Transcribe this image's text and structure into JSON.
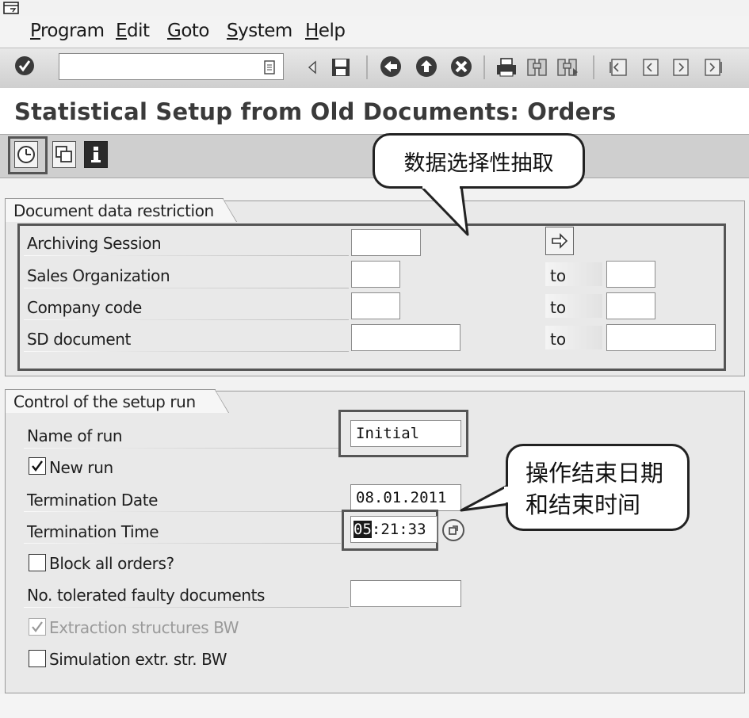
{
  "menu": {
    "program": "Program",
    "edit": "Edit",
    "goto": "Goto",
    "system": "System",
    "help": "Help"
  },
  "page_title": "Statistical Setup from Old Documents: Orders",
  "doc_restriction": {
    "title": "Document data restriction",
    "rows": [
      {
        "label": "Archiving Session"
      },
      {
        "label": "Sales Organization",
        "to": "to"
      },
      {
        "label": "Company code",
        "to": "to"
      },
      {
        "label": "SD document",
        "to": "to"
      }
    ]
  },
  "setup_control": {
    "title": "Control of the setup run",
    "name_of_run": {
      "label": "Name of run",
      "value": "Initial"
    },
    "new_run": {
      "label": "New run",
      "checked": true
    },
    "termination_date": {
      "label": "Termination Date",
      "value": "08.01.2011"
    },
    "termination_time": {
      "label": "Termination Time",
      "selected": "05",
      "rest": ":21:33"
    },
    "block_all": {
      "label": "Block all orders?",
      "checked": false
    },
    "tolerated": {
      "label": "No. tolerated faulty documents"
    },
    "extraction_bw": {
      "label": "Extraction structures BW",
      "checked": true,
      "disabled": true
    },
    "simulation_bw": {
      "label": "Simulation extr. str. BW",
      "checked": false
    }
  },
  "callouts": {
    "selective": "数据选择性抽取",
    "end_line1": "操作结束日期",
    "end_line2": "和结束时间"
  },
  "icons": [
    "window-menu-icon",
    "enter-check-icon",
    "history-dropdown-icon",
    "back-arrow-icon",
    "save-icon",
    "back-icon",
    "exit-icon",
    "cancel-icon",
    "print-icon",
    "find-icon",
    "find-next-icon",
    "first-page-icon",
    "previous-page-icon",
    "next-page-icon",
    "last-page-icon",
    "execute-icon",
    "copy-icon",
    "info-icon",
    "multiple-selection-icon",
    "time-help-icon"
  ]
}
